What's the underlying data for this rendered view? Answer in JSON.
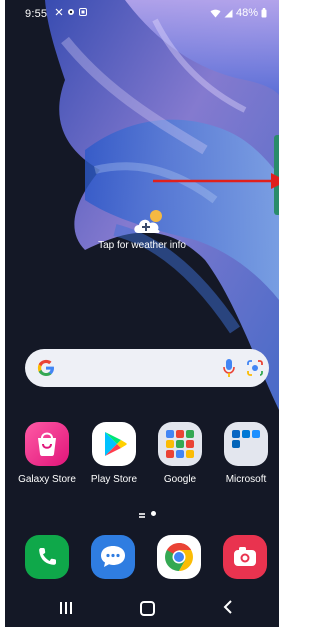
{
  "status_bar": {
    "time": "9:55",
    "battery": "48%"
  },
  "weather": {
    "label": "Tap for weather info"
  },
  "apps": [
    {
      "label": "Galaxy Store",
      "icon": "galaxy-store-icon"
    },
    {
      "label": "Play Store",
      "icon": "play-store-icon"
    },
    {
      "label": "Google",
      "icon": "google-folder-icon"
    },
    {
      "label": "Microsoft",
      "icon": "microsoft-folder-icon"
    }
  ],
  "dock": [
    {
      "icon": "phone-icon"
    },
    {
      "icon": "messages-icon"
    },
    {
      "icon": "chrome-icon"
    },
    {
      "icon": "camera-icon"
    }
  ],
  "colors": {
    "background": "#141826",
    "annotation_arrow": "#e0201c",
    "search_bar": "#eef0f6"
  }
}
